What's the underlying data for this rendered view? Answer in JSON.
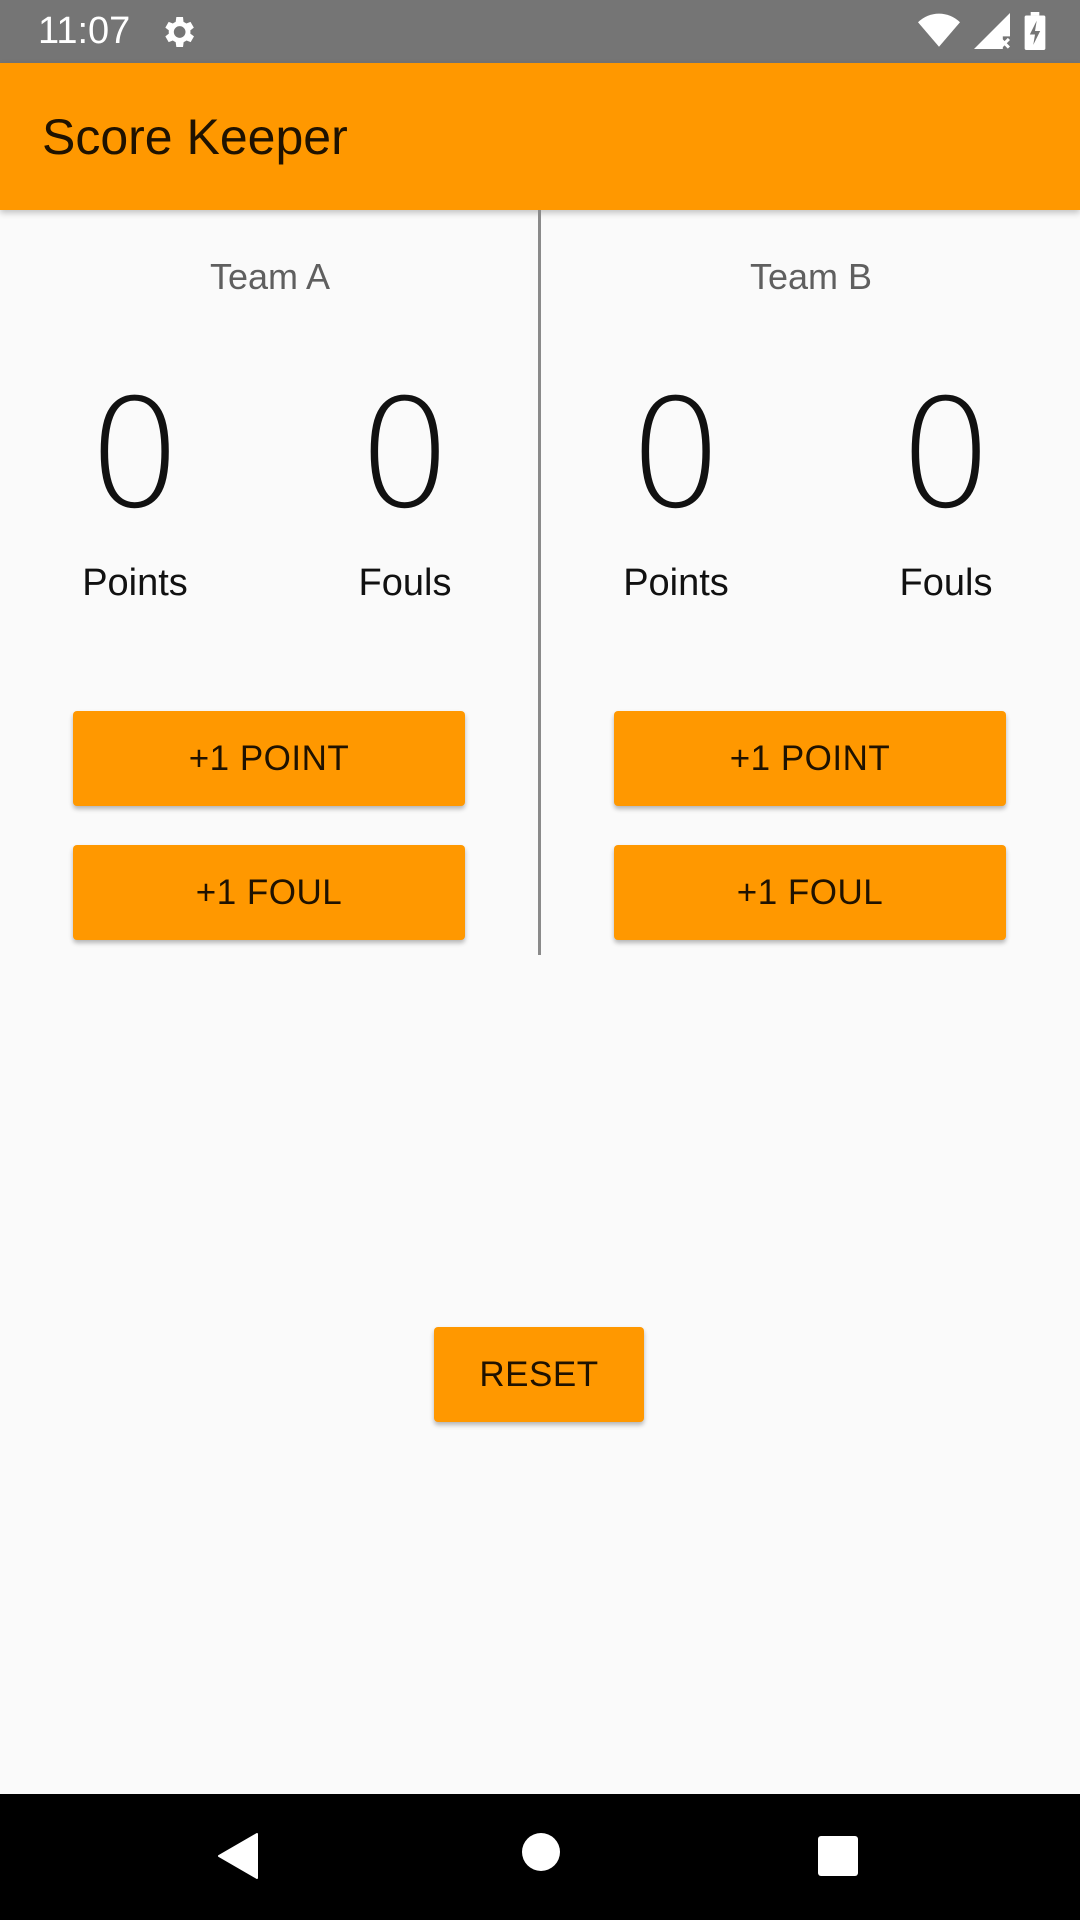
{
  "status_bar": {
    "time": "11:07",
    "icons": [
      "gear-icon",
      "wifi-icon",
      "signal-icon",
      "battery-icon"
    ],
    "background": "#757575"
  },
  "app_bar": {
    "title": "Score Keeper",
    "background": "#ff9800"
  },
  "teams": [
    {
      "name": "Team A",
      "points": {
        "value": "0",
        "label": "Points"
      },
      "fouls": {
        "value": "0",
        "label": "Fouls"
      },
      "point_button": "+1 POINT",
      "foul_button": "+1 FOUL"
    },
    {
      "name": "Team B",
      "points": {
        "value": "0",
        "label": "Points"
      },
      "fouls": {
        "value": "0",
        "label": "Fouls"
      },
      "point_button": "+1 POINT",
      "foul_button": "+1 FOUL"
    }
  ],
  "reset_button": "RESET",
  "nav_bar": {
    "icons": [
      "back-icon",
      "home-icon",
      "recents-icon"
    ]
  },
  "colors": {
    "accent": "#ff9800",
    "background": "#fafafa",
    "divider": "#8a8a8a"
  }
}
